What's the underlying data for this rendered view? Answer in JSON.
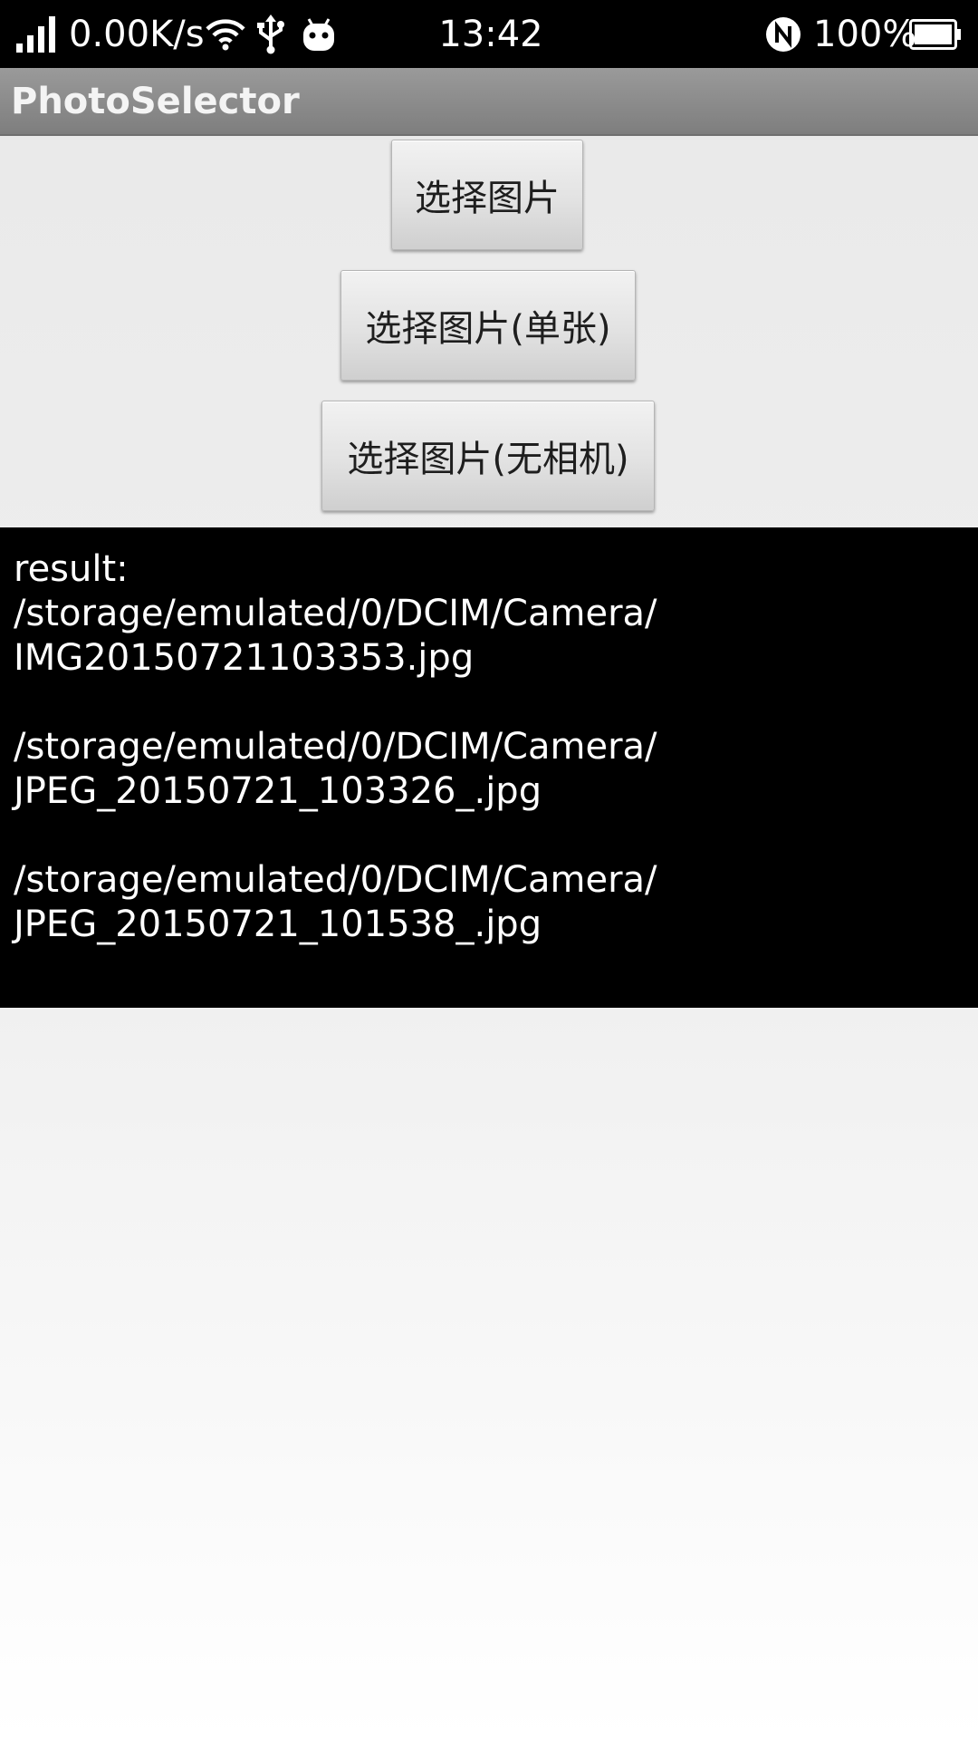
{
  "status_bar": {
    "network_speed": "0.00K/s",
    "time": "13:42",
    "battery_percent": "100%",
    "icons": [
      "signal-icon",
      "wifi-icon",
      "usb-icon",
      "android-icon",
      "nfc-icon",
      "battery-icon"
    ]
  },
  "app_bar": {
    "title": "PhotoSelector"
  },
  "buttons": {
    "select_photo": "选择图片",
    "select_photo_single": "选择图片(单张)",
    "select_photo_no_camera": "选择图片(无相机)"
  },
  "result": {
    "text": "result:\n/storage/emulated/0/DCIM/Camera/\nIMG20150721103353.jpg\n\n/storage/emulated/0/DCIM/Camera/\nJPEG_20150721_103326_.jpg\n\n/storage/emulated/0/DCIM/Camera/\nJPEG_20150721_101538_.jpg"
  },
  "colors": {
    "status_bar_bg": "#000000",
    "action_bar_bg": "#8a8a8a",
    "result_bg": "#000000",
    "result_text": "#ffffff"
  }
}
